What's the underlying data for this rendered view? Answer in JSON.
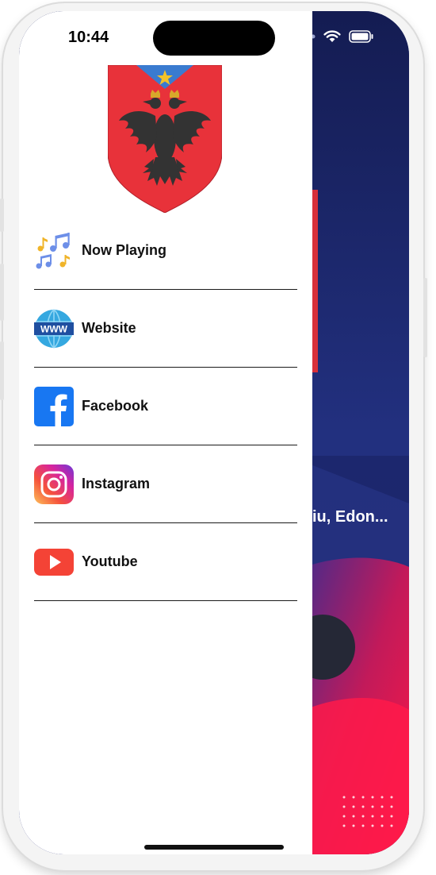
{
  "status_bar": {
    "time": "10:44"
  },
  "drawer": {
    "items": [
      {
        "label": "Now Playing",
        "icon": "music-notes-icon"
      },
      {
        "label": "Website",
        "icon": "www-globe-icon"
      },
      {
        "label": "Facebook",
        "icon": "facebook-icon"
      },
      {
        "label": "Instagram",
        "icon": "instagram-icon"
      },
      {
        "label": "Youtube",
        "icon": "youtube-icon"
      }
    ]
  },
  "background": {
    "track_text": "iu, Edon..."
  },
  "colors": {
    "background_dark_blue": "#1b2a78",
    "background_pink": "#e8164f",
    "crest_red": "#e8323a",
    "crest_blue": "#3a7bd0"
  }
}
